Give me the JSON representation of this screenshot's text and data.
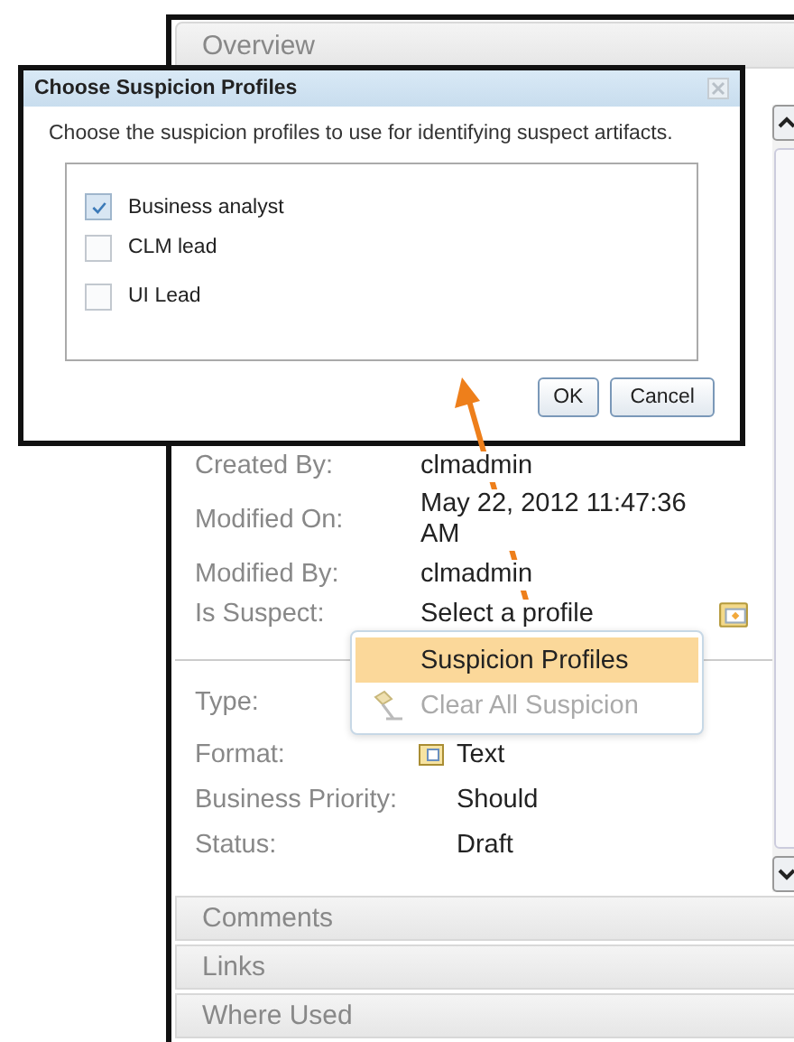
{
  "panel": {
    "header": "Overview",
    "fields_top": [
      {
        "label": "Created By:",
        "value": "clmadmin",
        "kind": "text"
      },
      {
        "label": "Modified On:",
        "value": "May 22, 2012 11:47:36 AM",
        "kind": "text"
      },
      {
        "label": "Modified By:",
        "value": "clmadmin",
        "kind": "text"
      },
      {
        "label": "Is Suspect:",
        "value": "Select a profile",
        "kind": "profile"
      }
    ],
    "fields_bottom": [
      {
        "label": "Type:",
        "kind": "text"
      },
      {
        "label": "Format:",
        "value": "Text",
        "kind": "format"
      },
      {
        "label": "Business Priority:",
        "value": "Should",
        "kind": "text"
      },
      {
        "label": "Status:",
        "value": "Draft",
        "kind": "text"
      }
    ],
    "sections": [
      "Comments",
      "Links",
      "Where Used"
    ]
  },
  "dialog": {
    "title": "Choose Suspicion Profiles",
    "description": "Choose the suspicion profiles to use for identifying suspect artifacts.",
    "profiles": [
      {
        "label": "Business analyst",
        "checked": true
      },
      {
        "label": "CLM lead",
        "checked": false
      },
      {
        "label": "UI Lead",
        "checked": false
      }
    ],
    "buttons": [
      "OK",
      "Cancel"
    ]
  },
  "menu": {
    "items": [
      {
        "label": "Suspicion Profiles",
        "selected": true,
        "disabled": false,
        "kind": "plain"
      },
      {
        "label": "Clear All Suspicion",
        "selected": false,
        "disabled": true,
        "kind": "clear"
      }
    ]
  }
}
